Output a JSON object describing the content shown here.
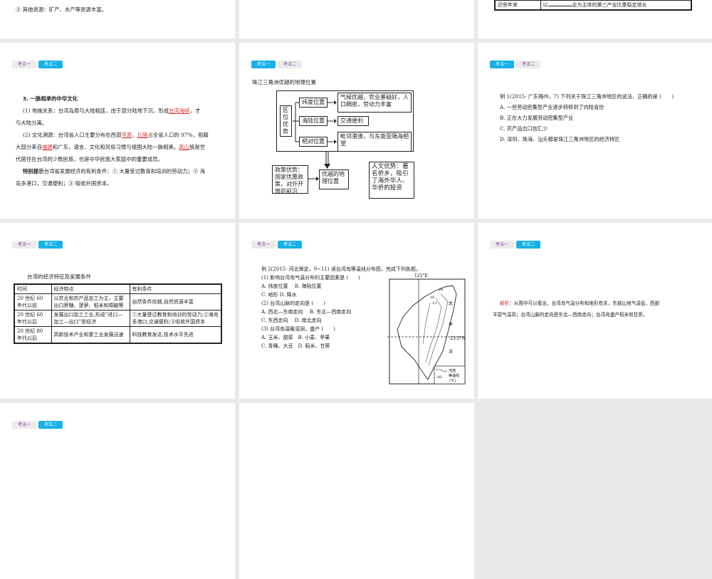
{
  "tabs": {
    "point1": "考点一",
    "point2": "考点二",
    "method1": "考法一",
    "method2": "考法二"
  },
  "s0a": {
    "line": "② 其他资源：矿产、水产等资源丰富。"
  },
  "s0c": {
    "c1": "近些年来",
    "c2a": "以",
    "c2b": "业为主体的第三产业比重稳定增长"
  },
  "s1": {
    "heading": "3. 一脉相承的中华文化",
    "p1a": "(1) 地缘关系：台湾岛原与大陆相连，由于部分陆地下沉，形成",
    "p1r": "台湾海峡",
    "p1b": "，才",
    "p1c": "与大陆分离。",
    "p2a": "(2) 文化渊源：台湾省人口主要分布在西部",
    "p2r1": "平原",
    "p2m": "，",
    "p2r2": "丘陵",
    "p2b": "占全省人口的 97%，祖籍",
    "p2c": "大部分来自",
    "p2r3": "福建",
    "p2d": "和广东，语言、文化和风俗习惯与祖国大陆一脉相承。",
    "p2r4": "高山",
    "p2e": "族是世",
    "p2f": "代居住在台湾的少数民族，也是中华民族大家庭中的重要成员。",
    "tip_label": "特别提示",
    "tip1": "台湾省发展经济的有利条件：① 大量受过教育和培训的劳动力；② 海",
    "tip2": "岛多港口，交通便利；③ 吸收外国资本。"
  },
  "s2": {
    "title": "珠江三角洲优越的地理位置",
    "root": "区位优势",
    "r1": "纬度位置",
    "r1d": "气候优越，农业基础好，人口稠密，劳动力丰富",
    "r2": "海陆位置",
    "r2d": "交通便利",
    "r3": "相对位置",
    "r3d": "毗邻港澳，与东南亚隔海相望",
    "center": "优越的地理位置",
    "left": "政策优势：国家优惠政策，对外开放的前沿",
    "right": "人文优势：著名侨乡，吸引了海外华人、华侨的投资"
  },
  "s3": {
    "q": "例 1(2015· 广东梅州，7) 下列关于珠江三角洲地区的说法，正确的是 (　　)",
    "a": "A. 一些劳动密集型产业逐步转移到了内陆省份",
    "b": "B. 正在大力发展劳动密集型产业",
    "c": "C. 农产品出口创汇少",
    "d": "D. 深圳、珠海、汕头都是珠江三角洲地区的经济特区"
  },
  "s4": {
    "title": "台湾的经济特征及发展条件",
    "headers": [
      "时间",
      "经济特点",
      "有利条件"
    ],
    "rows": [
      [
        "20 世纪 60 年代以前",
        "以农业和农产品加工为主，主要出口蔗糖、菠萝、稻米和樟脑等",
        "自然条件优越,自然资源丰富"
      ],
      [
        "20 世纪 60 年代以后",
        "发展出口加工工业,形成“进口—加工—出口”型经济",
        "①大量受过教育和培训的劳动力;②海岛多港口,交通便利;③吸收外国资本"
      ],
      [
        "20 世纪 80 年代以后",
        "高新技术产业和重工业发展迅速",
        "科技教育发达,技术水平先进"
      ]
    ]
  },
  "s5": {
    "q": "例 2(2015· 河北保定，9~11) 读台湾岛等温线分布图，完成下列各题。",
    "lines": [
      "(1) 影响台湾岛气温分布的主要因素是 (　　)",
      "A. 纬度位置　 B. 海陆位置",
      "C. 地形 D. 降水",
      "(2) 台湾山脉的走向是 (　　)",
      "A. 西北—东南走向　 B. 东北—西南走向",
      "C. 东西走向　 D. 南北走向",
      "(3) 台湾岛温暖湿润，盛产 (　　)",
      "A. 玉米、甜菜　B. 小麦、苹果",
      "C. 青稞、大豆　D. 稻米、甘蔗"
    ],
    "map": {
      "lon": "121°E",
      "lat": "23.5°N",
      "ocean1": "太",
      "ocean2": "平",
      "ocean3": "洋",
      "iso20": "20",
      "iso16": "16",
      "iso12": "12",
      "leg1": "河流",
      "leg2": "等温线",
      "leg3": "(℃)",
      "leg16": "-16-"
    }
  },
  "s6": {
    "label": "解析",
    "l1": "：从图中可以看出，台湾岛气温分布和地形有关，东部山地气温低，西部",
    "l2": "平原气温高；台湾山脉的走向是东北—西南走向；台湾岛盛产稻米和甘蔗。"
  },
  "colors": {
    "active_tab": "#17b1e9",
    "inactive_tab_text": "#8a3d9e",
    "answer_red": "#dd3333"
  }
}
